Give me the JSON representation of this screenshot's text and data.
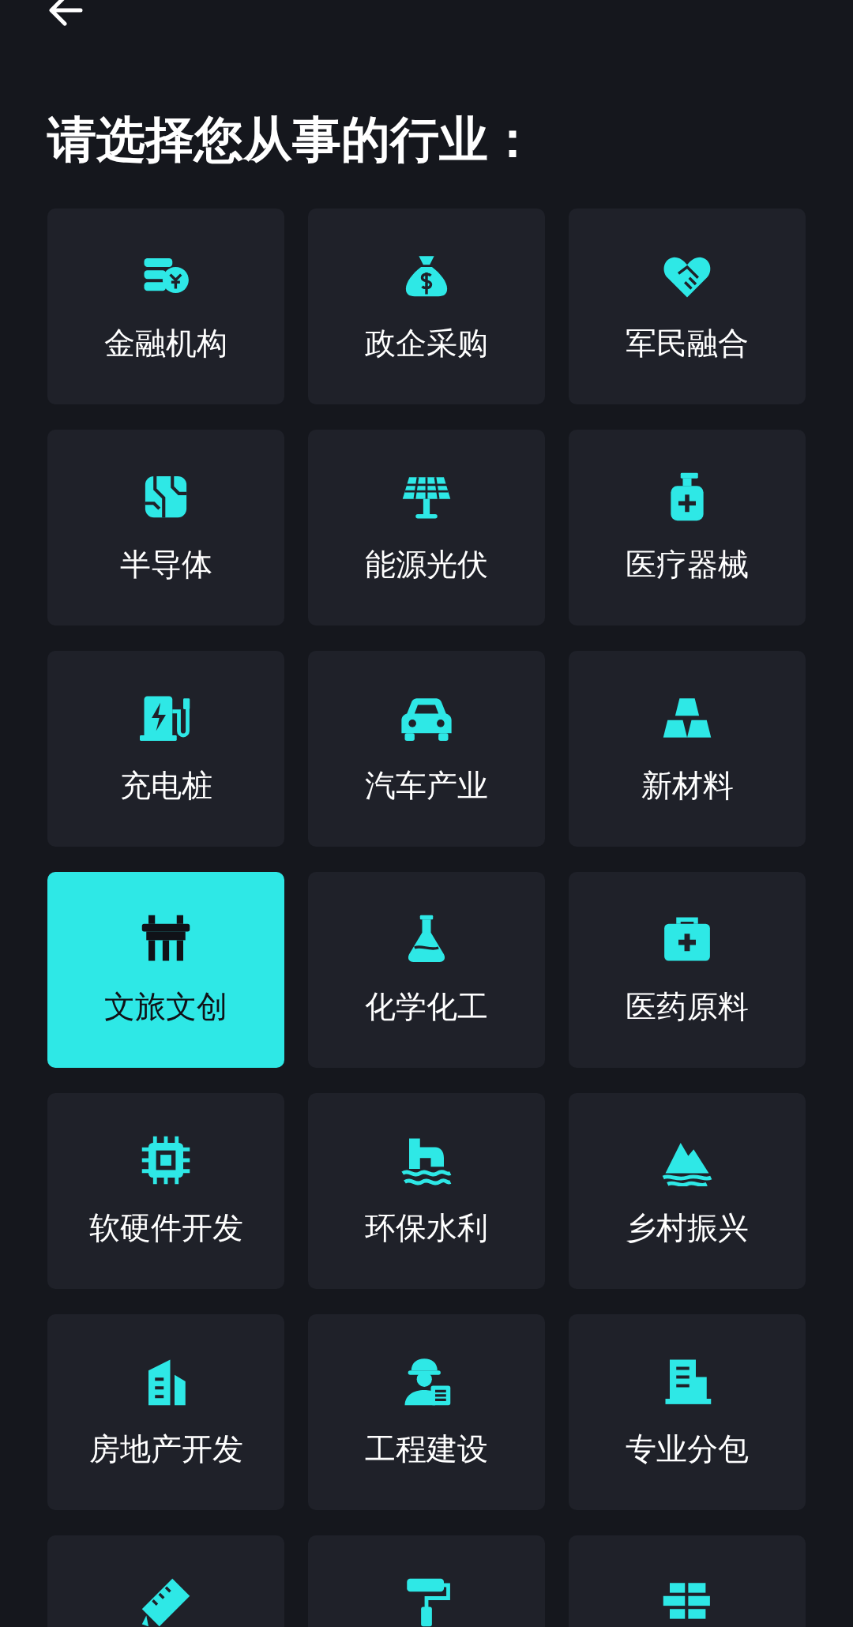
{
  "title": "请选择您从事的行业：",
  "industries": [
    {
      "label": "金融机构",
      "selected": false
    },
    {
      "label": "政企采购",
      "selected": false
    },
    {
      "label": "军民融合",
      "selected": false
    },
    {
      "label": "半导体",
      "selected": false
    },
    {
      "label": "能源光伏",
      "selected": false
    },
    {
      "label": "医疗器械",
      "selected": false
    },
    {
      "label": "充电桩",
      "selected": false
    },
    {
      "label": "汽车产业",
      "selected": false
    },
    {
      "label": "新材料",
      "selected": false
    },
    {
      "label": "文旅文创",
      "selected": true
    },
    {
      "label": "化学化工",
      "selected": false
    },
    {
      "label": "医药原料",
      "selected": false
    },
    {
      "label": "软硬件开发",
      "selected": false
    },
    {
      "label": "环保水利",
      "selected": false
    },
    {
      "label": "乡村振兴",
      "selected": false
    },
    {
      "label": "房地产开发",
      "selected": false
    },
    {
      "label": "工程建设",
      "selected": false
    },
    {
      "label": "专业分包",
      "selected": false
    },
    {
      "selected": false
    },
    {
      "selected": false
    },
    {
      "selected": false
    }
  ]
}
